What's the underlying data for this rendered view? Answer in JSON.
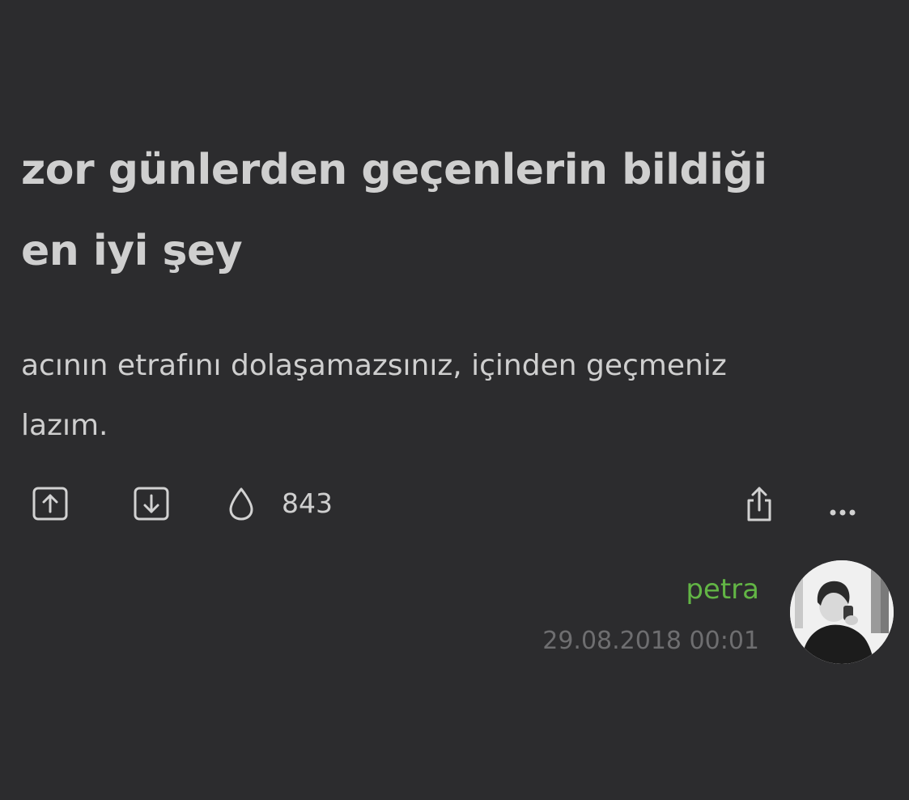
{
  "entry": {
    "title_line1": "zor günlerden geçenlerin bildiği",
    "title_line2": "en iyi şey",
    "body_line1": "acının etrafını dolaşamazsınız, içinden geçmeniz",
    "body_line2": "lazım.",
    "favorite_count": "843",
    "author": "petra",
    "date": "29.08.2018 00:01"
  },
  "icons": {
    "upvote": "arrow-up-square-icon",
    "downvote": "arrow-down-square-icon",
    "favorite": "drop-icon",
    "share": "share-icon",
    "more": "more-dots-icon"
  },
  "colors": {
    "background": "#2c2c2e",
    "text": "#cfcfcf",
    "author": "#62b545",
    "date": "#6e6e70"
  }
}
